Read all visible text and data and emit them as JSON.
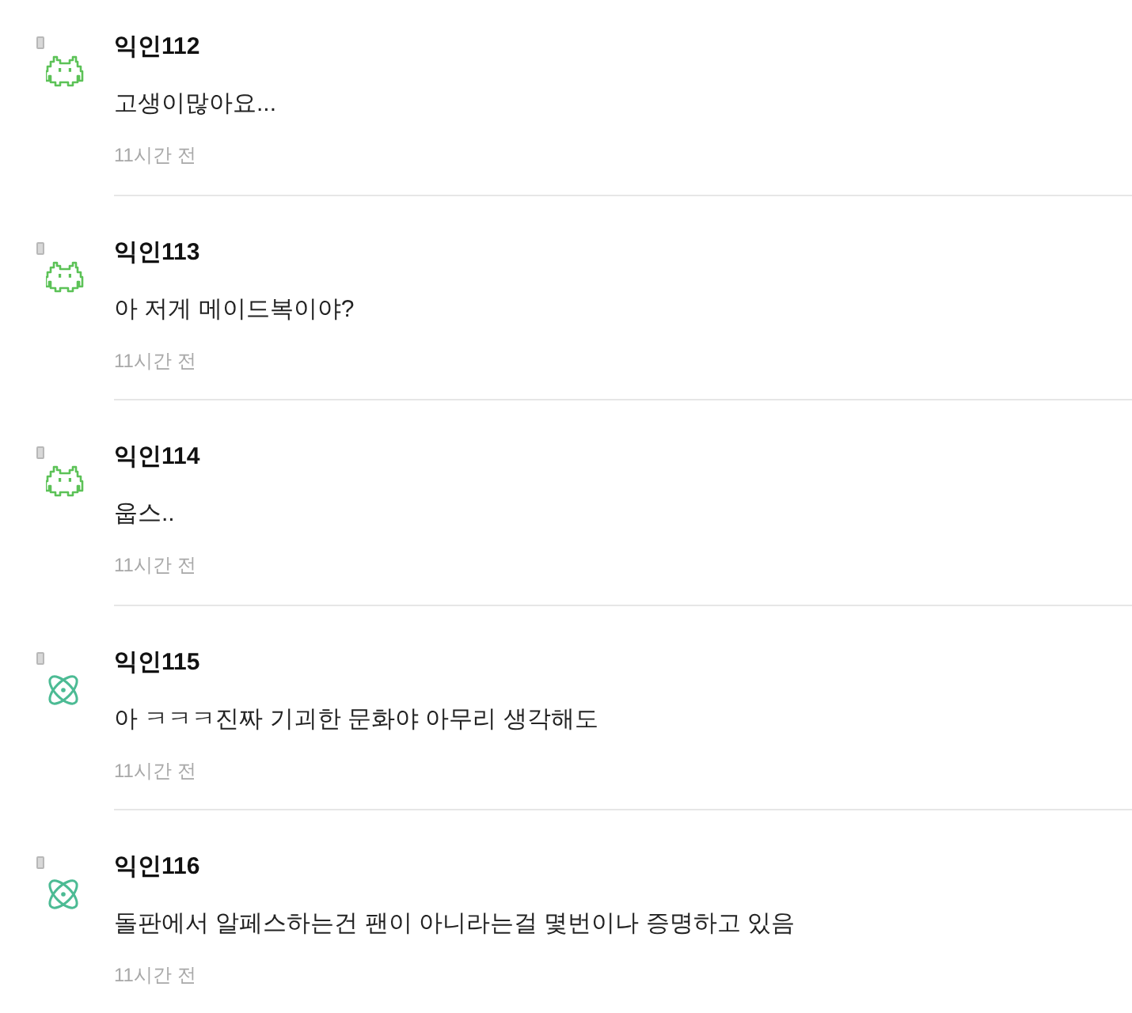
{
  "comments": [
    {
      "avatar": {
        "kind": "invader"
      },
      "author": "익인112",
      "text": "고생이많아요...",
      "time": "11시간 전"
    },
    {
      "avatar": {
        "kind": "invader"
      },
      "author": "익인113",
      "text": "아 저게 메이드복이야?",
      "time": "11시간 전"
    },
    {
      "avatar": {
        "kind": "invader"
      },
      "author": "익인114",
      "text": "웁스..",
      "time": "11시간 전"
    },
    {
      "avatar": {
        "kind": "atom"
      },
      "author": "익인115",
      "text": "아 ㅋㅋㅋ진짜 기괴한 문화야 아무리 생각해도",
      "time": "11시간 전"
    },
    {
      "avatar": {
        "kind": "atom"
      },
      "author": "익인116",
      "text": "돌판에서 알페스하는건 팬이 아니라는걸 몇번이나 증명하고 있음",
      "time": "11시간 전"
    }
  ]
}
